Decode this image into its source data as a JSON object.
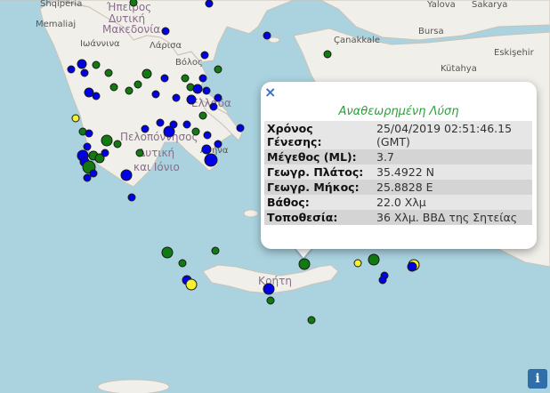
{
  "map": {
    "labels": {
      "albania": "Shqipëria",
      "memaliaj": "Memaliaj",
      "ipeiros": "Ήπειρος",
      "ipeiros_dytiki": "Δυτική",
      "makedonia": "Μακεδονία",
      "ioannina": "Ιωάννινα",
      "larisa": "Λάρισα",
      "volos": "Βόλος",
      "ellada": "Ελλάδα",
      "peloponnisos": "Πελοπόννησος",
      "dytiki_ellada": "Δυτική",
      "kai_ionio": "και Ιόνιο",
      "athina": "Αθήνα",
      "kriti": "Κρήτη",
      "yalova": "Yalova",
      "sakarya": "Sakarya",
      "canakkale": "Çanakkale",
      "bursa": "Bursa",
      "eskisehir": "Eskişehir",
      "kutahya": "Kütahya"
    },
    "marker_colors": {
      "blue": "#0000e6",
      "green": "#117a11",
      "yellow": "#f5f032",
      "stroke": "#1a1a1a"
    }
  },
  "popup": {
    "close_symbol": "×",
    "title": "Αναθεωρημένη Λύση",
    "rows": [
      {
        "label": "Χρόνος Γένεσης:",
        "value": "25/04/2019 02:51:46.15 (GMT)"
      },
      {
        "label": "Μέγεθος (ML):",
        "value": "3.7"
      },
      {
        "label": "Γεωγρ. Πλάτος:",
        "value": "35.4922 N"
      },
      {
        "label": "Γεωγρ. Μήκος:",
        "value": "25.8828 E"
      },
      {
        "label": "Βάθος:",
        "value": "22.0 Χλμ"
      },
      {
        "label": "Τοποθεσία:",
        "value": "36 Χλμ. ΒΒΔ της Σητείας"
      }
    ]
  },
  "info_button": "i"
}
